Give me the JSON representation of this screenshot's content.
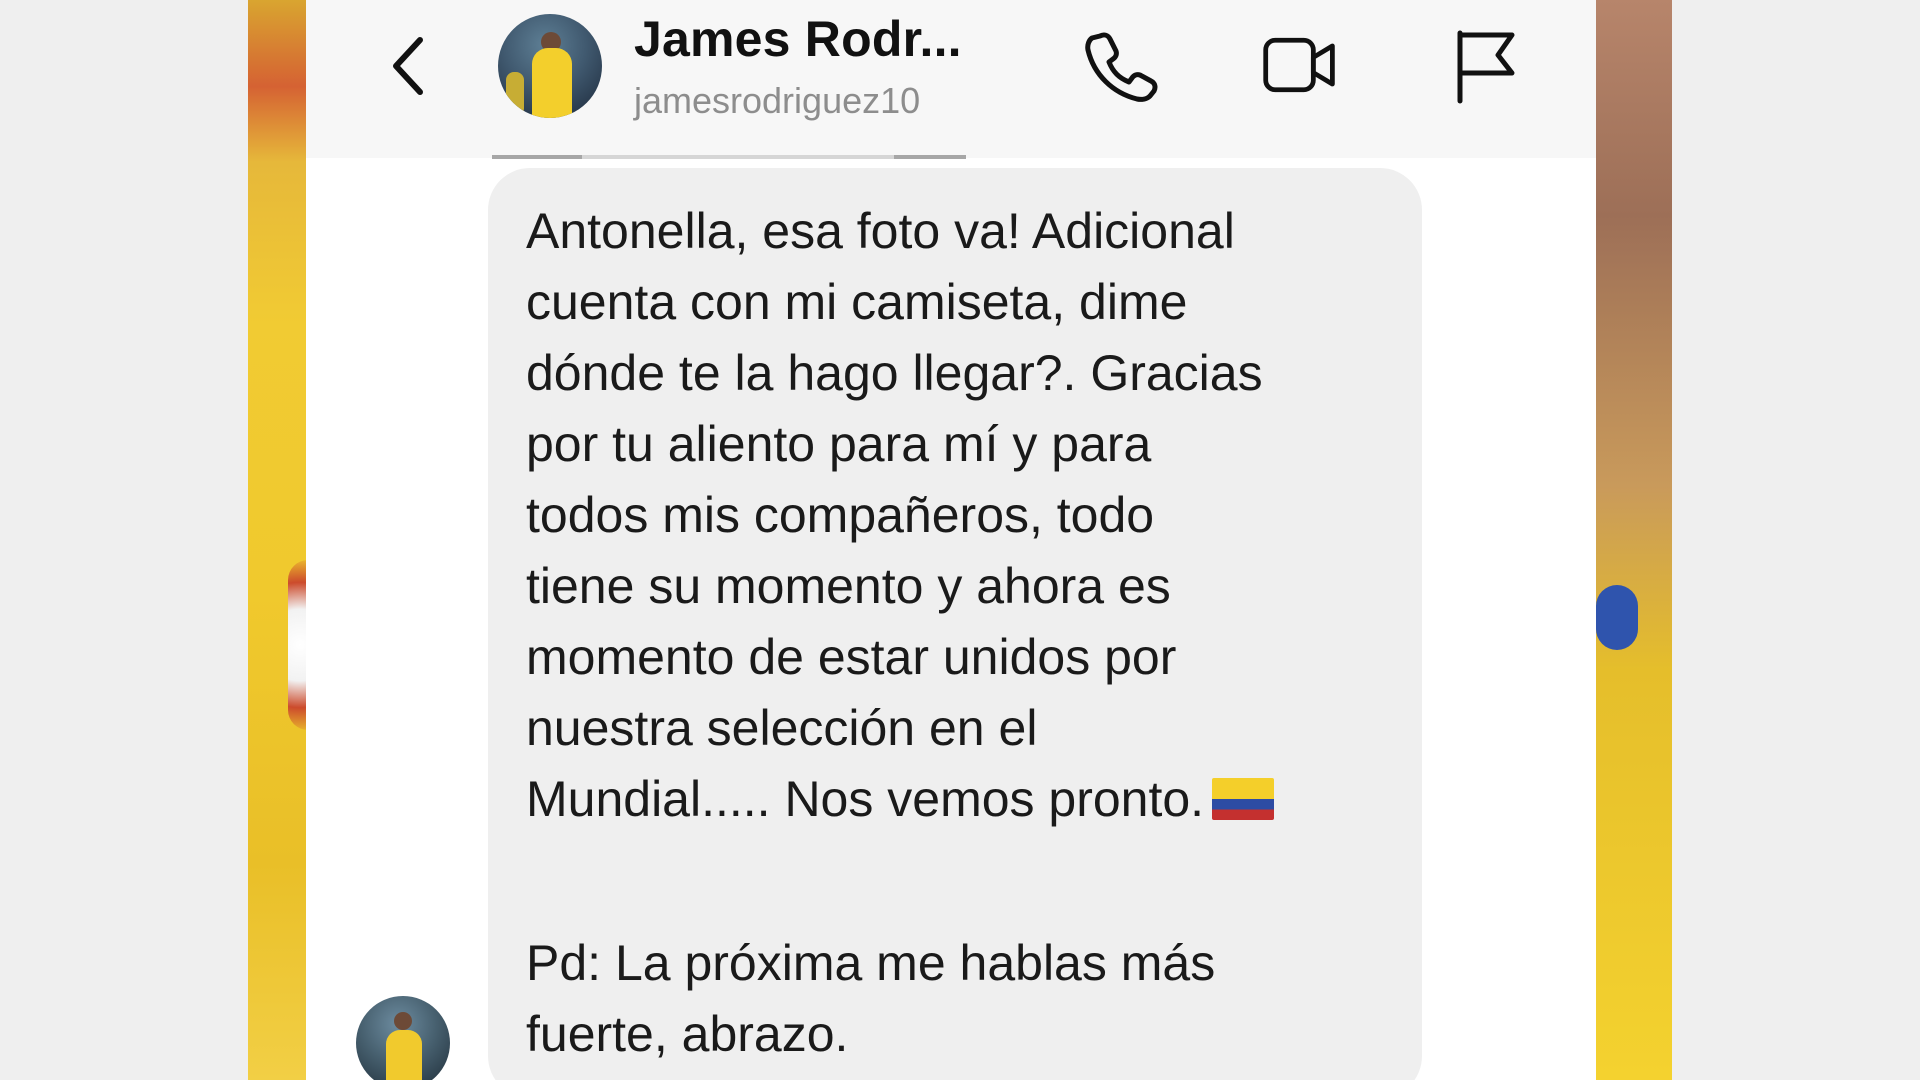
{
  "header": {
    "back_icon": "chevron-left-icon",
    "name": "James Rodr...",
    "username": "jamesrodriguez10",
    "actions": {
      "phone_icon": "phone-icon",
      "video_icon": "video-camera-icon",
      "flag_icon": "flag-icon"
    }
  },
  "message": {
    "text": "Antonella, esa foto va! Adicional\ncuenta con mi camiseta, dime\ndónde te la hago llegar?. Gracias\npor tu aliento para mí y para\ntodos mis compañeros, todo\ntiene su momento y ahora es\nmomento de estar unidos por\nnuestra selección en el\nMundial..... Nos vemos pronto.",
    "flag_emoji": "🇨🇴",
    "ps": "Pd: La próxima me hablas más\nfuerte, abrazo."
  },
  "colors": {
    "panel": "#ffffff",
    "bubble": "#efefef",
    "name": "#111111",
    "username": "#8d8d8d"
  }
}
